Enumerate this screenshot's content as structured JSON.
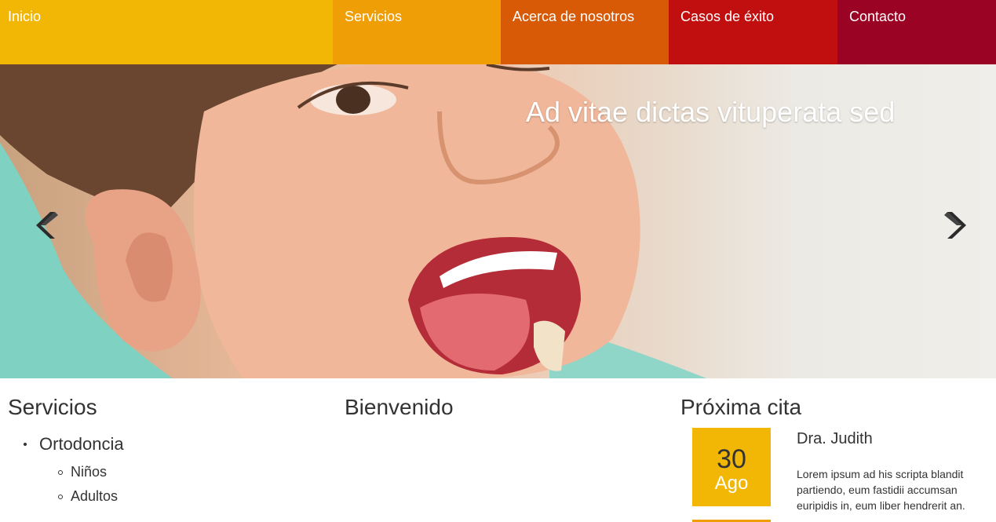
{
  "nav": {
    "items": [
      {
        "label": "Inicio",
        "color": "#f2b705"
      },
      {
        "label": "Servicios",
        "color": "#f09e05"
      },
      {
        "label": "Acerca de nosotros",
        "color": "#d85a07"
      },
      {
        "label": "Casos de éxito",
        "color": "#c10e0e"
      },
      {
        "label": "Contacto",
        "color": "#9a0324"
      }
    ]
  },
  "hero": {
    "caption": "Ad vitae dictas vituperata sed",
    "prev_icon": "chevron-left-icon",
    "next_icon": "chevron-right-icon",
    "image": "smiling-child-at-dentist"
  },
  "services": {
    "title": "Servicios",
    "items": [
      {
        "label": "Ortodoncia",
        "children": [
          {
            "label": "Niños"
          },
          {
            "label": "Adultos"
          }
        ]
      }
    ]
  },
  "welcome": {
    "title": "Bienvenido"
  },
  "appointment": {
    "title": "Próxima cita",
    "day": "30",
    "month": "Ago",
    "doctor": "Dra. Judith",
    "description": "Lorem ipsum ad his scripta blandit partiendo, eum fastidii accumsan euripidis in, eum liber hendrerit an."
  }
}
